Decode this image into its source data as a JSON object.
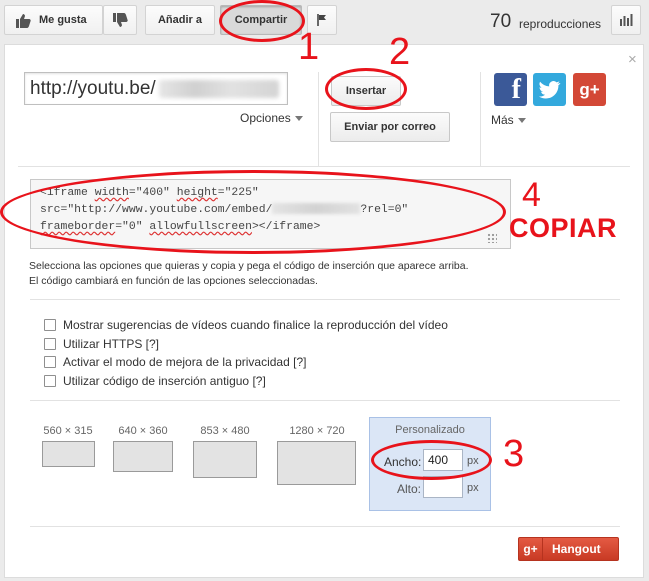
{
  "toolbar": {
    "like_label": "Me gusta",
    "add_label": "Añadir a",
    "share_label": "Compartir",
    "views_count": "70",
    "views_label": "reproducciones"
  },
  "share": {
    "url_prefix": "http://youtu.be/",
    "options_label": "Opciones",
    "embed_button": "Insertar",
    "email_button": "Enviar por correo",
    "more_label": "Más",
    "close": "×"
  },
  "embed": {
    "line1_a": "<iframe ",
    "line1_w": "width",
    "line1_b": "=\"400\" ",
    "line1_h": "height",
    "line1_c": "=\"225\"",
    "line2_a": "src=\"http://www.youtube.com/embed/",
    "line2_b": "?rel=0\"",
    "line3_a": "frameborder",
    "line3_b": "=\"0\" ",
    "line3_c": "allowfullscreen",
    "line3_d": "></iframe>",
    "help_line1": "Selecciona las opciones que quieras y copia y pega el código de inserción que aparece arriba.",
    "help_line2": "El código cambiará en función de las opciones seleccionadas."
  },
  "checkboxes": [
    "Mostrar sugerencias de vídeos cuando finalice la reproducción del vídeo",
    "Utilizar HTTPS [?]",
    "Activar el modo de mejora de la privacidad [?]",
    "Utilizar código de inserción antiguo [?]"
  ],
  "sizes": [
    "560 × 315",
    "640 × 360",
    "853 × 480",
    "1280 × 720"
  ],
  "custom": {
    "title": "Personalizado",
    "width_label": "Ancho:",
    "width_value": "400",
    "height_label": "Alto:",
    "height_value": "",
    "unit": "px"
  },
  "hangout": {
    "icon": "g+",
    "label": "Hangout"
  },
  "annotations": {
    "n1": "1",
    "n2": "2",
    "n3": "3",
    "n4": "4",
    "copiar": "COPIAR"
  },
  "colors": {
    "annotation": "#e8131b",
    "facebook": "#3b5998",
    "twitter": "#33a9dd",
    "gplus": "#d34836"
  }
}
